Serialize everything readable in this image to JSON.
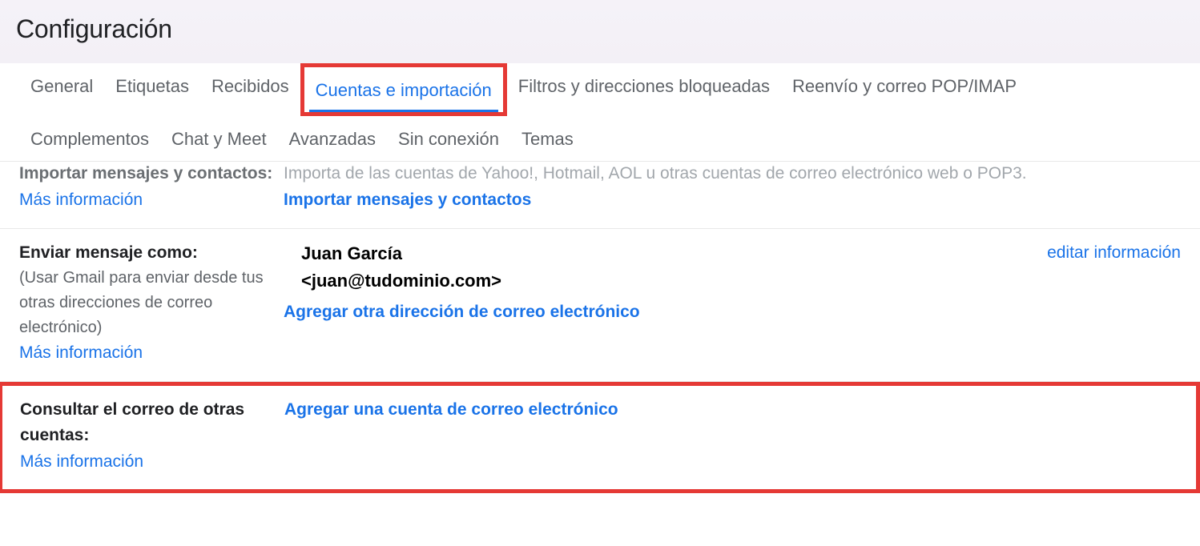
{
  "page": {
    "title": "Configuración"
  },
  "tabs": {
    "row1": [
      {
        "label": "General"
      },
      {
        "label": "Etiquetas"
      },
      {
        "label": "Recibidos"
      },
      {
        "label": "Cuentas e importación",
        "active": true,
        "highlighted": true
      },
      {
        "label": "Filtros y direcciones bloqueadas"
      },
      {
        "label": "Reenvío y correo POP/IMAP"
      }
    ],
    "row2": [
      {
        "label": "Complementos"
      },
      {
        "label": "Chat y Meet"
      },
      {
        "label": "Avanzadas"
      },
      {
        "label": "Sin conexión"
      },
      {
        "label": "Temas"
      }
    ]
  },
  "sections": {
    "import": {
      "title": "Importar mensajes y contactos:",
      "learn_more": "Más información",
      "description": "Importa de las cuentas de Yahoo!, Hotmail, AOL u otras cuentas de correo electrónico web o POP3.",
      "action": "Importar mensajes y contactos"
    },
    "send_as": {
      "title": "Enviar mensaje como:",
      "subtitle": "(Usar Gmail para enviar desde tus otras direcciones de correo electrónico)",
      "learn_more": "Más información",
      "identity_name": "Juan García",
      "identity_email": "<juan@tudominio.com>",
      "add_another": "Agregar otra dirección de correo electrónico",
      "edit_info": "editar información"
    },
    "check_mail": {
      "title": "Consultar el correo de otras cuentas:",
      "learn_more": "Más información",
      "add_account": "Agregar una cuenta de correo electrónico"
    }
  }
}
